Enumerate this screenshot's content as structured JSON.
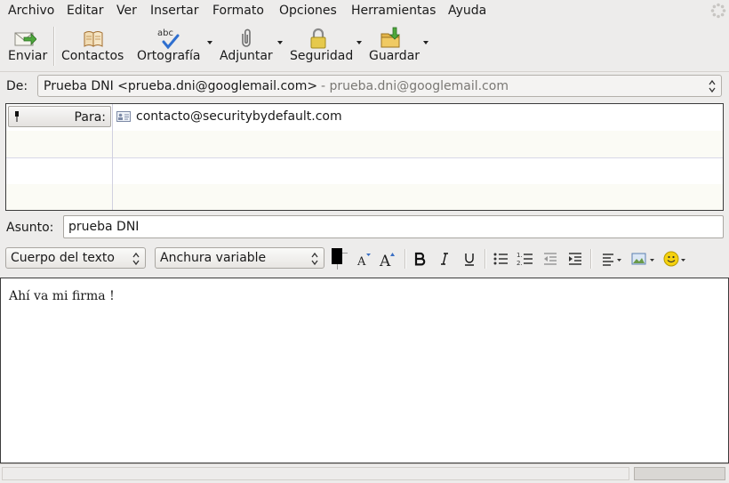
{
  "menubar": {
    "items": [
      "Archivo",
      "Editar",
      "Ver",
      "Insertar",
      "Formato",
      "Opciones",
      "Herramientas",
      "Ayuda"
    ]
  },
  "toolbar": {
    "send": "Enviar",
    "contacts": "Contactos",
    "spelling": "Ortografía",
    "spelling_icon_text": "abc",
    "attach": "Adjuntar",
    "security": "Seguridad",
    "save": "Guardar"
  },
  "from": {
    "label": "De:",
    "name": "Prueba DNI <prueba.dni@googlemail.com>",
    "account": "- prueba.dni@googlemail.com"
  },
  "recipients": [
    {
      "type": "Para:",
      "address": "contacto@securitybydefault.com"
    }
  ],
  "subject": {
    "label": "Asunto:",
    "value": "prueba DNI"
  },
  "format": {
    "paragraph_style": "Cuerpo del texto",
    "font": "Anchura variable",
    "text_color": "#000000"
  },
  "body": {
    "text": "Ahí va mi firma !"
  }
}
